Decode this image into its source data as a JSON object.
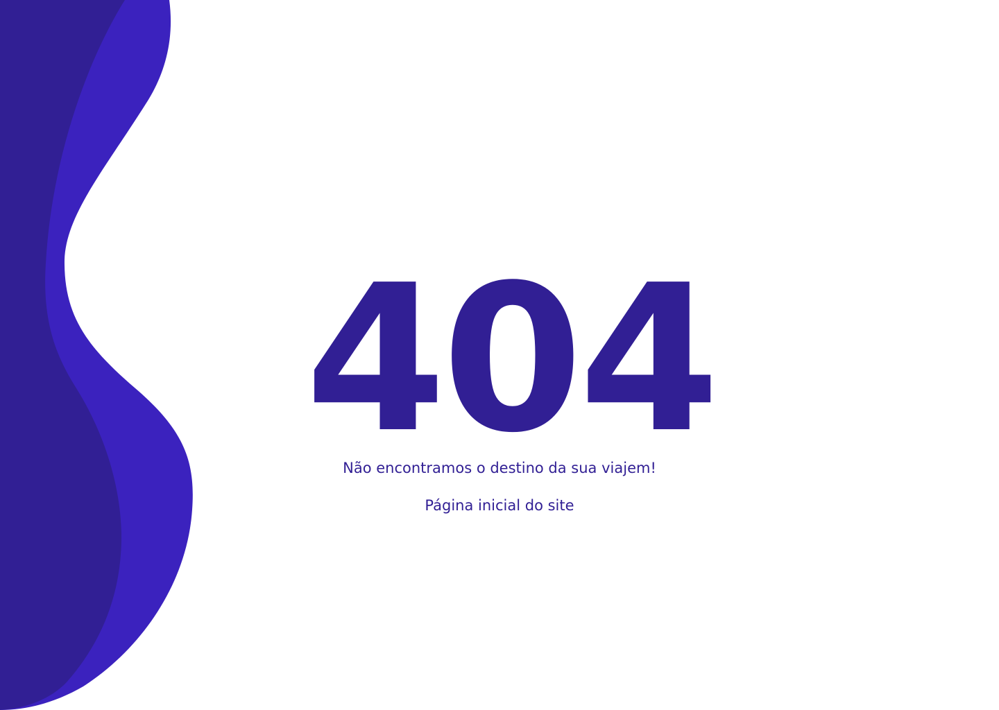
{
  "error": {
    "code": "404",
    "message": "Não encontramos o destino da sua viajem!",
    "home_link_label": "Página inicial do site"
  },
  "colors": {
    "primary": "#311f94",
    "accent": "#3b22be",
    "background": "#ffffff"
  }
}
